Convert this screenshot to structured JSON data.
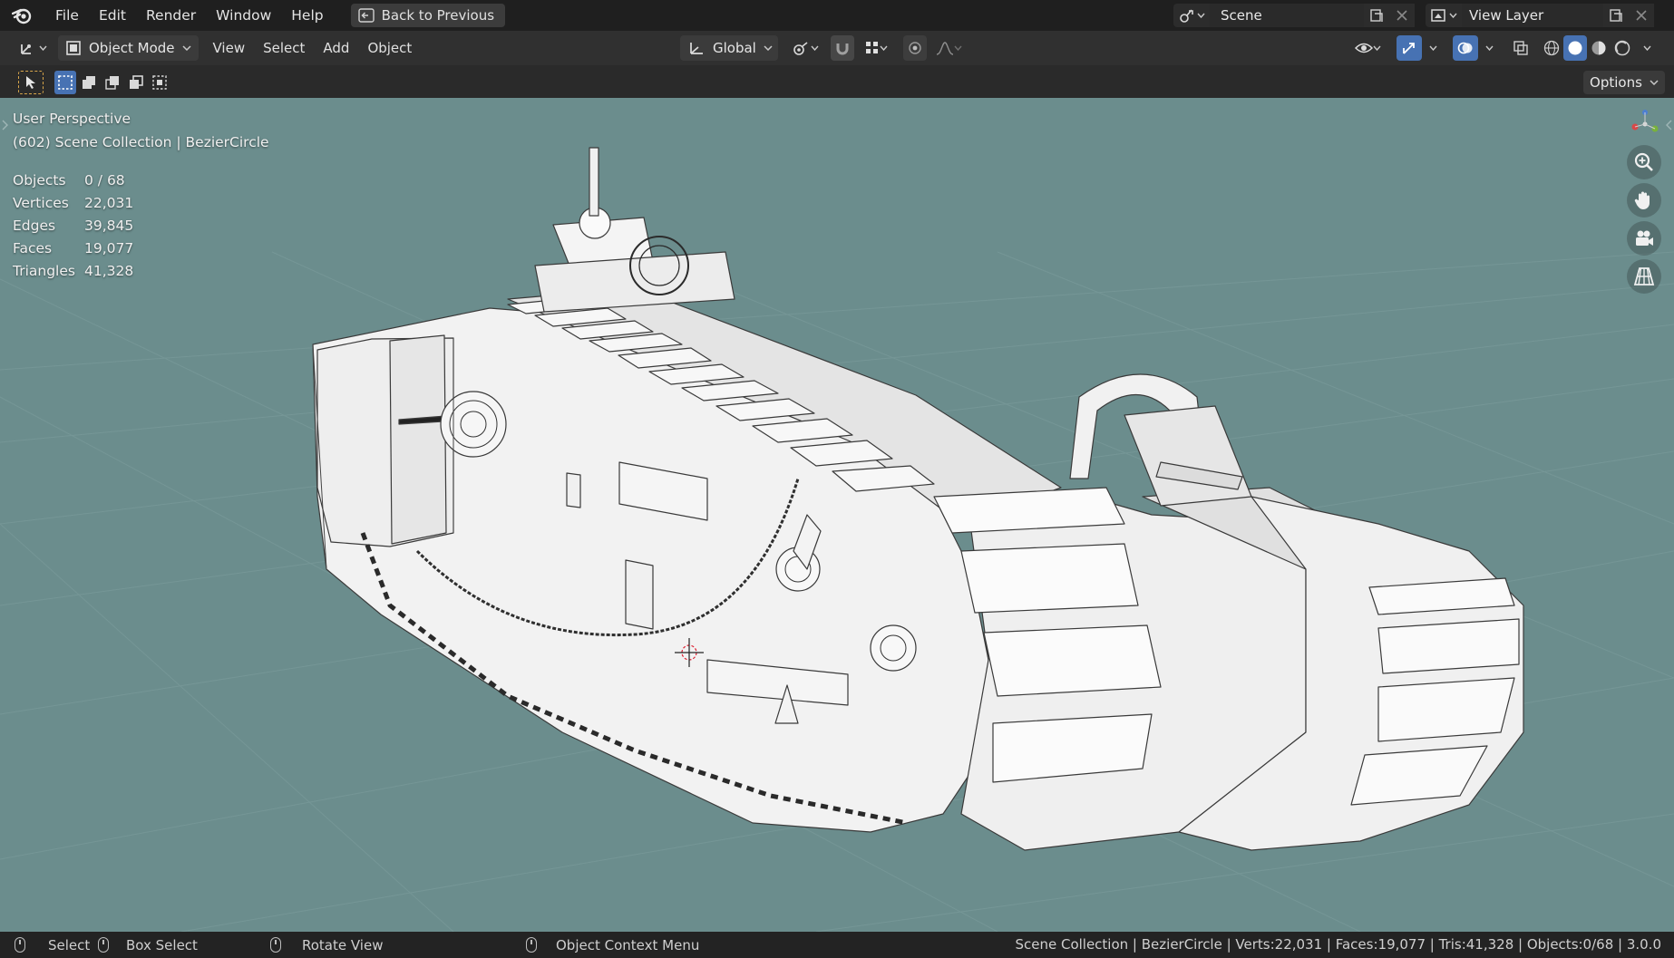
{
  "menu": {
    "items": [
      "File",
      "Edit",
      "Render",
      "Window",
      "Help"
    ],
    "back_button": "Back to Previous"
  },
  "scene": {
    "name": "Scene"
  },
  "view_layer": {
    "name": "View Layer"
  },
  "viewport_header": {
    "mode": "Object Mode",
    "menus": [
      "View",
      "Select",
      "Add",
      "Object"
    ],
    "transform_orientation": "Global"
  },
  "tool_header": {
    "options_label": "Options"
  },
  "viewport": {
    "perspective": "User Perspective",
    "collection": "(602) Scene Collection | BezierCircle",
    "stats": [
      {
        "label": "Objects",
        "value": "0 / 68"
      },
      {
        "label": "Vertices",
        "value": "22,031"
      },
      {
        "label": "Edges",
        "value": "39,845"
      },
      {
        "label": "Faces",
        "value": "19,077"
      },
      {
        "label": "Triangles",
        "value": "41,328"
      }
    ]
  },
  "status_bar": {
    "select": "Select",
    "box_select": "Box Select",
    "rotate_view": "Rotate View",
    "context_menu": "Object Context Menu",
    "info": "Scene Collection | BezierCircle | Verts:22,031 | Faces:19,077 | Tris:41,328 | Objects:0/68 | 3.0.0"
  },
  "colors": {
    "viewport_bg": "#6b8d8d",
    "active_tool": "#4772b3",
    "select_dashed": "#d8a64b"
  }
}
